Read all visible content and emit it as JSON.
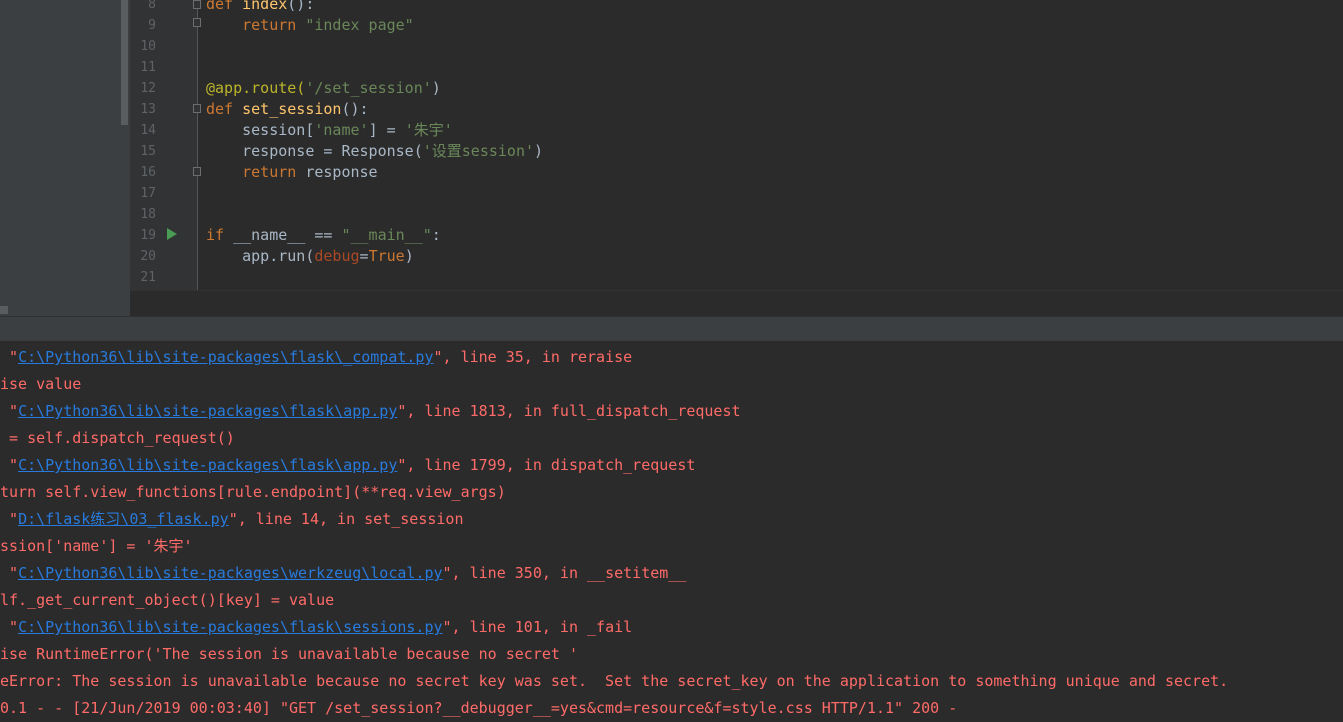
{
  "editor": {
    "line_numbers": [
      "8",
      "9",
      "10",
      "11",
      "12",
      "13",
      "14",
      "15",
      "16",
      "17",
      "18",
      "19",
      "20",
      "21"
    ],
    "lines": [
      [
        {
          "t": "def ",
          "c": "kw"
        },
        {
          "t": "index",
          "c": "fn"
        },
        {
          "t": "():",
          "c": ""
        }
      ],
      [
        {
          "t": "    ",
          "c": ""
        },
        {
          "t": "return ",
          "c": "kw"
        },
        {
          "t": "\"index page\"",
          "c": "str"
        }
      ],
      [],
      [],
      [
        {
          "t": "@app.route(",
          "c": "dec"
        },
        {
          "t": "'/set_session'",
          "c": "str"
        },
        {
          "t": ")",
          "c": ""
        }
      ],
      [
        {
          "t": "def ",
          "c": "kw"
        },
        {
          "t": "set_session",
          "c": "fn"
        },
        {
          "t": "():",
          "c": ""
        }
      ],
      [
        {
          "t": "    session[",
          "c": ""
        },
        {
          "t": "'name'",
          "c": "str"
        },
        {
          "t": "] = ",
          "c": ""
        },
        {
          "t": "'朱宇'",
          "c": "str"
        }
      ],
      [
        {
          "t": "    response = Response(",
          "c": ""
        },
        {
          "t": "'设置session'",
          "c": "str"
        },
        {
          "t": ")",
          "c": ""
        }
      ],
      [
        {
          "t": "    ",
          "c": ""
        },
        {
          "t": "return ",
          "c": "kw"
        },
        {
          "t": "response",
          "c": ""
        }
      ],
      [],
      [],
      [
        {
          "t": "if ",
          "c": "kw"
        },
        {
          "t": "__name__ == ",
          "c": ""
        },
        {
          "t": "\"__main__\"",
          "c": "str"
        },
        {
          "t": ":",
          "c": ""
        }
      ],
      [
        {
          "t": "    app.run(",
          "c": ""
        },
        {
          "t": "debug",
          "c": "param"
        },
        {
          "t": "=",
          "c": ""
        },
        {
          "t": "True",
          "c": "kw"
        },
        {
          "t": ")",
          "c": ""
        }
      ],
      []
    ]
  },
  "console": {
    "lines": [
      [
        {
          "t": " \"",
          "c": ""
        },
        {
          "t": "C:\\Python36\\lib\\site-packages\\flask\\_compat.py",
          "c": "link"
        },
        {
          "t": "\", line 35, in reraise",
          "c": ""
        }
      ],
      [
        {
          "t": "ise value",
          "c": ""
        }
      ],
      [
        {
          "t": " \"",
          "c": ""
        },
        {
          "t": "C:\\Python36\\lib\\site-packages\\flask\\app.py",
          "c": "link"
        },
        {
          "t": "\", line 1813, in full_dispatch_request",
          "c": ""
        }
      ],
      [
        {
          "t": " = self.dispatch_request()",
          "c": ""
        }
      ],
      [
        {
          "t": " \"",
          "c": ""
        },
        {
          "t": "C:\\Python36\\lib\\site-packages\\flask\\app.py",
          "c": "link"
        },
        {
          "t": "\", line 1799, in dispatch_request",
          "c": ""
        }
      ],
      [
        {
          "t": "turn self.view_functions[rule.endpoint](**req.view_args)",
          "c": ""
        }
      ],
      [
        {
          "t": " \"",
          "c": ""
        },
        {
          "t": "D:\\flask练习\\03_flask.py",
          "c": "link"
        },
        {
          "t": "\", line 14, in set_session",
          "c": ""
        }
      ],
      [
        {
          "t": "ssion['name'] = '朱宇'",
          "c": ""
        }
      ],
      [
        {
          "t": " \"",
          "c": ""
        },
        {
          "t": "C:\\Python36\\lib\\site-packages\\werkzeug\\local.py",
          "c": "link"
        },
        {
          "t": "\", line 350, in __setitem__",
          "c": ""
        }
      ],
      [
        {
          "t": "lf._get_current_object()[key] = value",
          "c": ""
        }
      ],
      [
        {
          "t": " \"",
          "c": ""
        },
        {
          "t": "C:\\Python36\\lib\\site-packages\\flask\\sessions.py",
          "c": "link"
        },
        {
          "t": "\", line 101, in _fail",
          "c": ""
        }
      ],
      [
        {
          "t": "ise RuntimeError('The session is unavailable because no secret '",
          "c": ""
        }
      ],
      [
        {
          "t": "eError: The session is unavailable because no secret key was set.  Set the secret_key on the application to something unique and secret.",
          "c": ""
        }
      ],
      [
        {
          "t": "0.1 - - [21/Jun/2019 00:03:40] \"GET /set_session?__debugger__=yes&cmd=resource&f=style.css HTTP/1.1\" 200 -",
          "c": ""
        }
      ]
    ]
  },
  "colors": {
    "background": "#2b2b2b",
    "keyword": "#cc7832",
    "string": "#6a8759",
    "error_text": "#ff6b68",
    "link": "#287bde"
  }
}
